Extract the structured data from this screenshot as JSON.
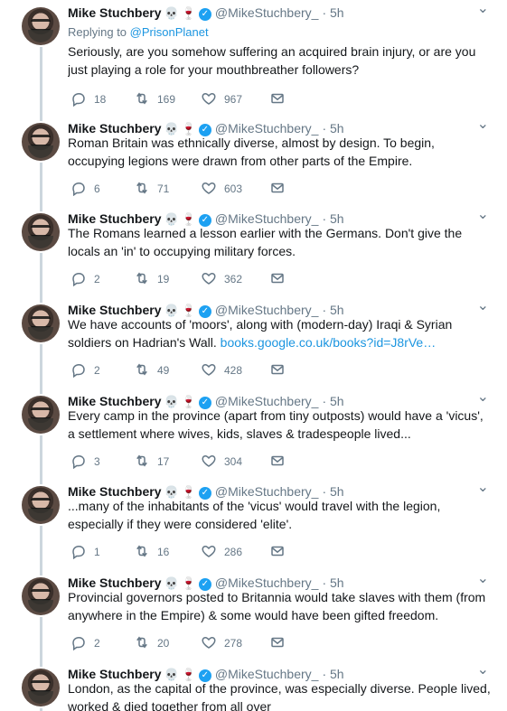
{
  "author": {
    "name": "Mike Stuchbery",
    "emoji": [
      "💀",
      "🍷"
    ],
    "handle": "@MikeStuchbery_",
    "time": "· 5h",
    "verified_icon": "verified-check-icon",
    "avatar_icon": "avatar-photo"
  },
  "first_reply": {
    "label": "Replying to ",
    "target": "@PrisonPlanet"
  },
  "colors": {
    "thread_line": "#ccd6dd",
    "verified_blue": "#1da1f2",
    "link_blue": "#1b95e0",
    "muted_text": "#657786"
  },
  "tweets": [
    {
      "text_before": "Seriously, are you somehow suffering an acquired brain injury, or are you just playing a role for your mouthbreather followers?",
      "link": "",
      "replies": "18",
      "retweets": "169",
      "likes": "967"
    },
    {
      "text_before": "Roman Britain was ethnically diverse, almost by design. To begin, occupying legions were drawn from other parts of the Empire.",
      "link": "",
      "replies": "6",
      "retweets": "71",
      "likes": "603"
    },
    {
      "text_before": "The Romans learned a lesson earlier with the Germans. Don't give the locals an 'in' to occupying military forces.",
      "link": "",
      "replies": "2",
      "retweets": "19",
      "likes": "362"
    },
    {
      "text_before": "We have accounts of 'moors', along with (modern-day) Iraqi & Syrian soldiers on Hadrian's Wall. ",
      "link": "books.google.co.uk/books?id=J8rVe…",
      "replies": "2",
      "retweets": "49",
      "likes": "428"
    },
    {
      "text_before": "Every camp in the province (apart from tiny outposts) would have a 'vicus', a settlement where wives, kids, slaves & tradespeople lived...",
      "link": "",
      "replies": "3",
      "retweets": "17",
      "likes": "304"
    },
    {
      "text_before": "...many of the inhabitants of the 'vicus' would travel with the legion, especially if they were considered 'elite'.",
      "link": "",
      "replies": "1",
      "retweets": "16",
      "likes": "286"
    },
    {
      "text_before": "Provincial governors posted to Britannia would take slaves with them (from anywhere in the Empire) & some would have been gifted freedom.",
      "link": "",
      "replies": "2",
      "retweets": "20",
      "likes": "278"
    },
    {
      "text_before": "London, as the capital of the province, was especially diverse. People lived, worked & died together from all over",
      "link": "",
      "replies": "",
      "retweets": "",
      "likes": ""
    }
  ]
}
